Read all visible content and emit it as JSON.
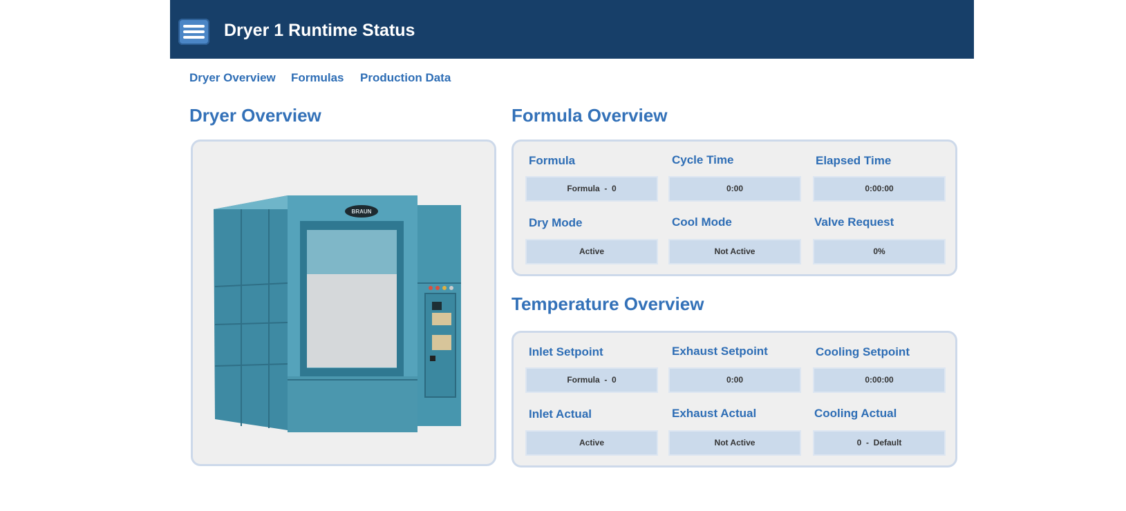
{
  "header": {
    "title": "Dryer 1 Runtime Status",
    "menu_icon": "hamburger-menu-icon"
  },
  "nav": {
    "items": [
      "Dryer Overview",
      "Formulas",
      "Production Data"
    ]
  },
  "dryer_section": {
    "title": "Dryer Overview",
    "image": "industrial-dryer-machine",
    "brand": "BRAUN"
  },
  "formula_section": {
    "title": "Formula Overview",
    "fields": [
      {
        "label": "Formula",
        "value": "Formula  -  0"
      },
      {
        "label": "Cycle Time",
        "value": "0:00"
      },
      {
        "label": "Elapsed Time",
        "value": "0:00:00"
      },
      {
        "label": "Dry Mode",
        "value": "Active"
      },
      {
        "label": "Cool Mode",
        "value": "Not Active"
      },
      {
        "label": "Valve Request",
        "value": "0%"
      }
    ]
  },
  "temperature_section": {
    "title": "Temperature Overview",
    "fields": [
      {
        "label": "Inlet Setpoint",
        "value": "Formula  -  0"
      },
      {
        "label": "Exhaust Setpoint",
        "value": "0:00"
      },
      {
        "label": "Cooling Setpoint",
        "value": "0:00:00"
      },
      {
        "label": "Inlet Actual",
        "value": "Active"
      },
      {
        "label": "Exhaust Actual",
        "value": "Not Active"
      },
      {
        "label": "Cooling Actual",
        "value": "0  -  Default"
      }
    ]
  },
  "colors": {
    "header_bg": "#173f69",
    "accent": "#3371b8",
    "value_bg": "#cbdaeb",
    "panel_bg": "#efefef"
  }
}
